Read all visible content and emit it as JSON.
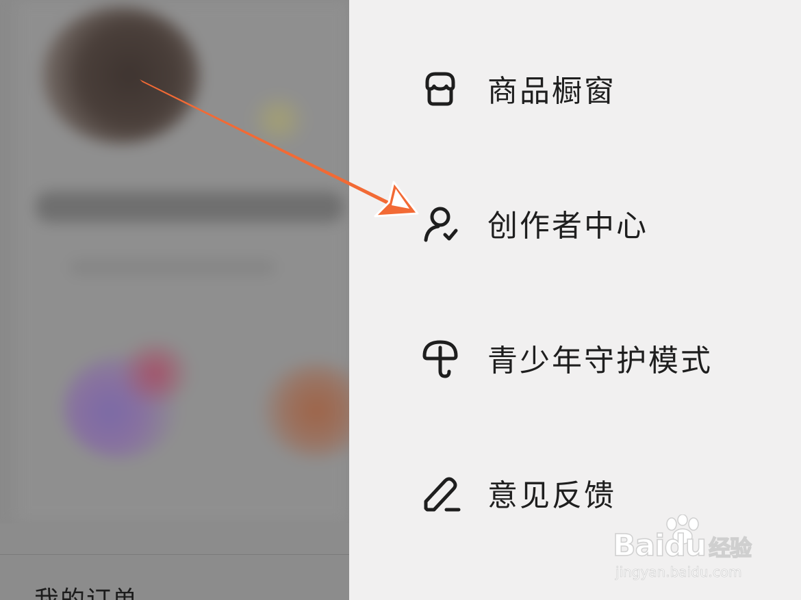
{
  "background_page": {
    "order_label": "我的订单"
  },
  "drawer_menu": {
    "items": [
      {
        "label": "商品橱窗",
        "icon": "storefront-icon"
      },
      {
        "label": "创作者中心",
        "icon": "creator-person-check-icon"
      },
      {
        "label": "青少年守护模式",
        "icon": "umbrella-icon"
      },
      {
        "label": "意见反馈",
        "icon": "pen-feedback-icon"
      }
    ]
  },
  "annotation": {
    "type": "arrow",
    "color": "#f26a35",
    "points_to": "创作者中心"
  },
  "watermark": {
    "brand": "Bai",
    "brand_suffix": "du",
    "brand_cn": "经验",
    "url": "jingyan.baidu.com"
  },
  "colors": {
    "drawer_bg": "#f1f0f0",
    "text": "#1e1e1e",
    "overlay": "#8a8a8a"
  }
}
